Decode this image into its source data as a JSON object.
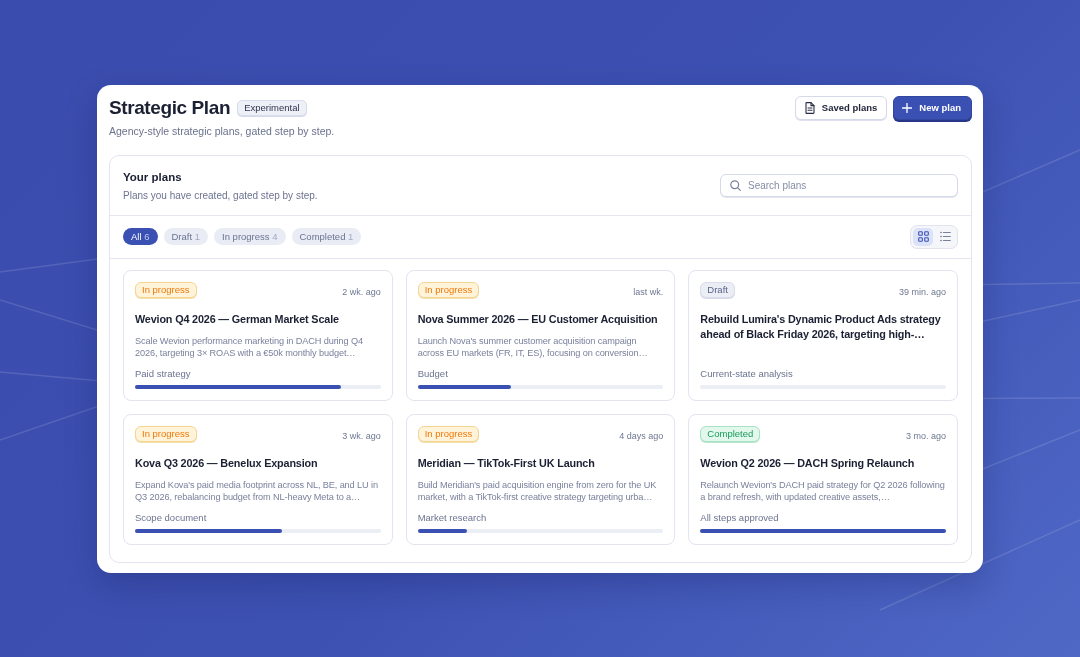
{
  "page": {
    "title": "Strategic Plan",
    "badge": "Experimental",
    "subtitle": "Agency-style strategic plans, gated step by step."
  },
  "actions": [
    {
      "label": "Saved plans",
      "kind": "secondary"
    },
    {
      "label": "New plan",
      "kind": "primary"
    }
  ],
  "panel": {
    "title": "Your plans",
    "subtitle": "Plans you have created, gated step by step.",
    "search": {
      "placeholder": "Search plans"
    }
  },
  "filters": [
    {
      "label": "All",
      "count": "6",
      "selected": true
    },
    {
      "label": "Draft",
      "count": "1",
      "selected": false
    },
    {
      "label": "In progress",
      "count": "4",
      "selected": false
    },
    {
      "label": "Completed",
      "count": "1",
      "selected": false
    }
  ],
  "view_options": [
    {
      "kind": "grid",
      "selected": true
    },
    {
      "kind": "list",
      "selected": false
    }
  ],
  "plans": [
    {
      "status": {
        "kind": "progress",
        "label": "In progress"
      },
      "time": "2 wk. ago",
      "title": "Wevion Q4 2026 — German Market Scale",
      "description": "Scale Wevion performance marketing in DACH during Q4 2026, targeting 3× ROAS with a €50k monthly budget…",
      "step": "Paid strategy",
      "level": 0.84
    },
    {
      "status": {
        "kind": "progress",
        "label": "In progress"
      },
      "time": "last wk.",
      "title": "Nova Summer 2026 — EU Customer Acquisition",
      "description": "Launch Nova's summer customer acquisition campaign across EU markets (FR, IT, ES), focusing on conversion…",
      "step": "Budget",
      "level": 0.38
    },
    {
      "status": {
        "kind": "draft",
        "label": "Draft"
      },
      "time": "39 min. ago",
      "title": "Rebuild Lumira's Dynamic Product Ads strategy ahead of Black Friday 2026, targeting high-…",
      "step": "Current-state analysis",
      "level": 0
    },
    {
      "status": {
        "kind": "progress",
        "label": "In progress"
      },
      "time": "3 wk. ago",
      "title": "Kova Q3 2026 — Benelux Expansion",
      "description": "Expand Kova's paid media footprint across NL, BE, and LU in Q3 2026, rebalancing budget from NL-heavy Meta to a…",
      "step": "Scope document",
      "level": 0.6
    },
    {
      "status": {
        "kind": "progress",
        "label": "In progress"
      },
      "time": "4 days ago",
      "title": "Meridian — TikTok-First UK Launch",
      "description": "Build Meridian's paid acquisition engine from zero for the UK market, with a TikTok-first creative strategy targeting urba…",
      "step": "Market research",
      "level": 0.2
    },
    {
      "status": {
        "kind": "completed",
        "label": "Completed"
      },
      "time": "3 mo. ago",
      "title": "Wevion Q2 2026 — DACH Spring Relaunch",
      "description": "Relaunch Wevion's DACH paid strategy for Q2 2026 following a brand refresh, with updated creative assets,…",
      "step": "All steps approved",
      "level": 1
    }
  ]
}
